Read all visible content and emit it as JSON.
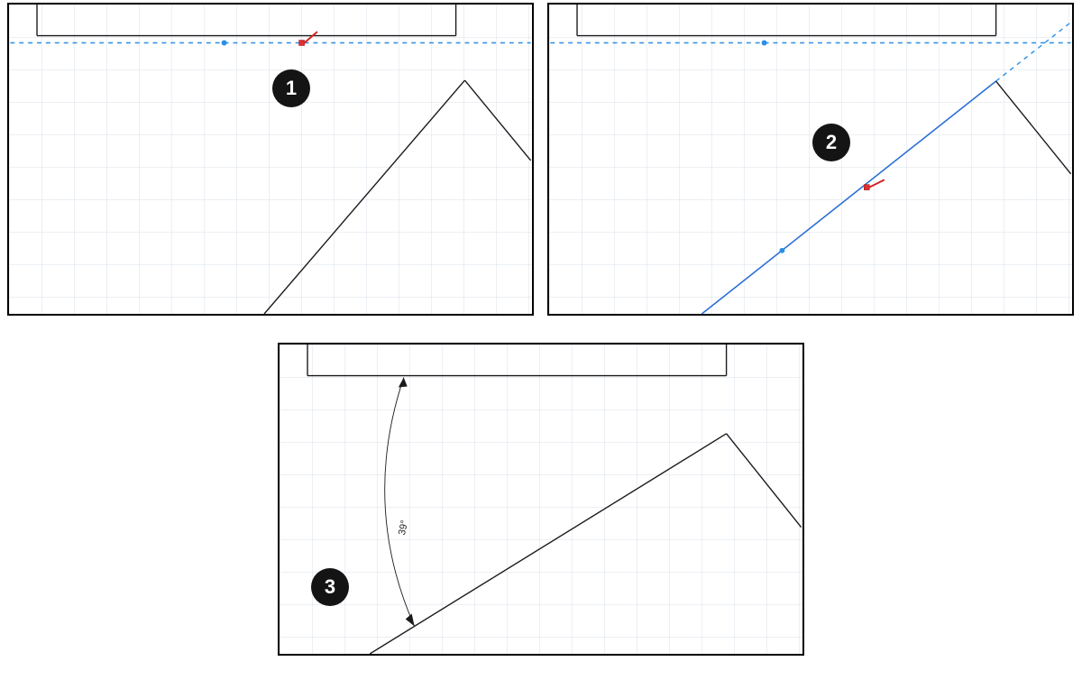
{
  "steps": {
    "one": "1",
    "two": "2",
    "three": "3"
  },
  "angle": {
    "value": "39°"
  }
}
